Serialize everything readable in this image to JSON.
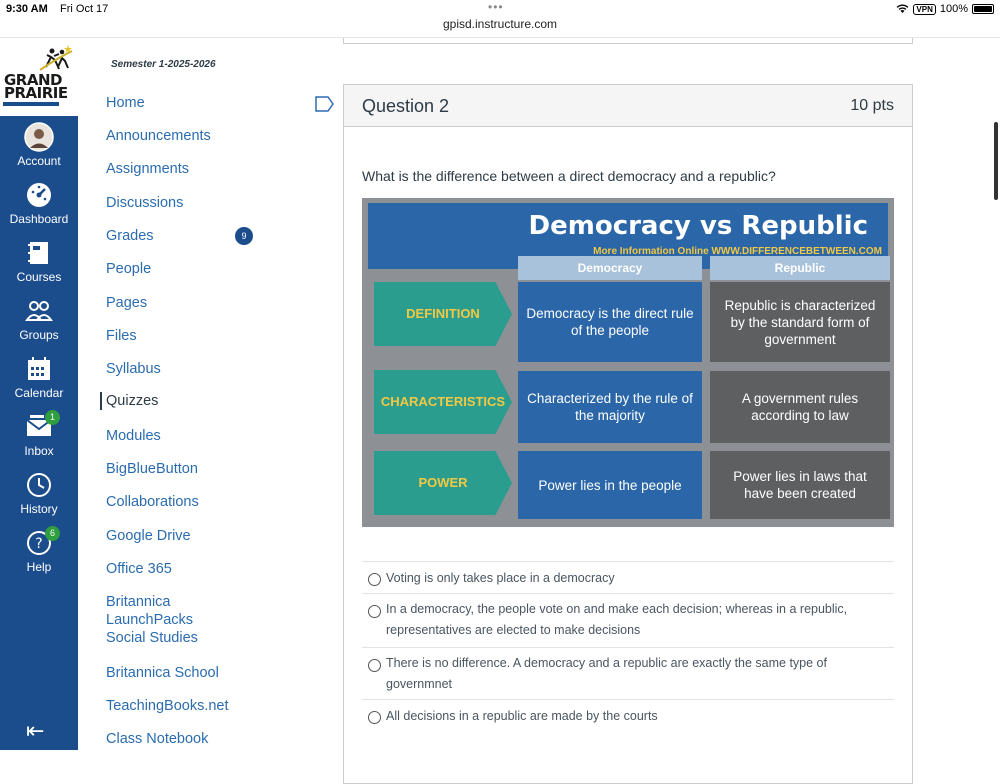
{
  "status": {
    "time": "9:30 AM",
    "date": "Fri Oct 17",
    "dots": "•••",
    "url": "gpisd.instructure.com",
    "vpn": "VPN",
    "battery": "100%"
  },
  "logo": {
    "text_line1": "GRAND",
    "text_line2": "PRAIRIE"
  },
  "global_nav": [
    {
      "label": "Account",
      "icon": "avatar-icon"
    },
    {
      "label": "Dashboard",
      "icon": "dashboard-icon"
    },
    {
      "label": "Courses",
      "icon": "courses-icon"
    },
    {
      "label": "Groups",
      "icon": "groups-icon"
    },
    {
      "label": "Calendar",
      "icon": "calendar-icon"
    },
    {
      "label": "Inbox",
      "icon": "inbox-icon",
      "badge": "1"
    },
    {
      "label": "History",
      "icon": "history-icon"
    },
    {
      "label": "Help",
      "icon": "help-icon",
      "badge": "6"
    }
  ],
  "collapse_glyph": "⇤",
  "course_nav": {
    "semester": "Semester 1-2025-2026",
    "items": [
      "Home",
      "Announcements",
      "Assignments",
      "Discussions",
      "Grades",
      "People",
      "Pages",
      "Files",
      "Syllabus",
      "Quizzes",
      "Modules",
      "BigBlueButton",
      "Collaborations",
      "Google Drive",
      "Office 365",
      "Britannica LaunchPacks Social Studies",
      "Britannica School",
      "TeachingBooks.net",
      "Class Notebook"
    ],
    "active": "Quizzes",
    "grades_badge": "9"
  },
  "question": {
    "title": "Question 2",
    "points": "10 pts",
    "text": "What is the difference between a direct democracy and a republic?",
    "infographic": {
      "title": "Democracy vs Republic",
      "more_info": "More Information Online  WWW.DIFFERENCEBETWEEN.COM",
      "col1": "Democracy",
      "col2": "Republic",
      "rows": [
        {
          "label": "DEFINITION",
          "democracy": "Democracy is the direct rule of the people",
          "republic": "Republic is characterized by the standard form of government"
        },
        {
          "label": "CHARACTERISTICS",
          "democracy": "Characterized by the rule of the majority",
          "republic": "A government rules according to law"
        },
        {
          "label": "POWER",
          "democracy": "Power lies in the people",
          "republic": "Power lies in laws that have been created"
        }
      ]
    },
    "answers": [
      "Voting is only takes place in a democracy",
      "In a democracy, the people vote on and make each decision; whereas in a republic, representatives are elected to make decisions",
      "There is no difference. A democracy and a republic are exactly the same type of governmnet",
      "All decisions in a republic are made by the courts"
    ]
  }
}
